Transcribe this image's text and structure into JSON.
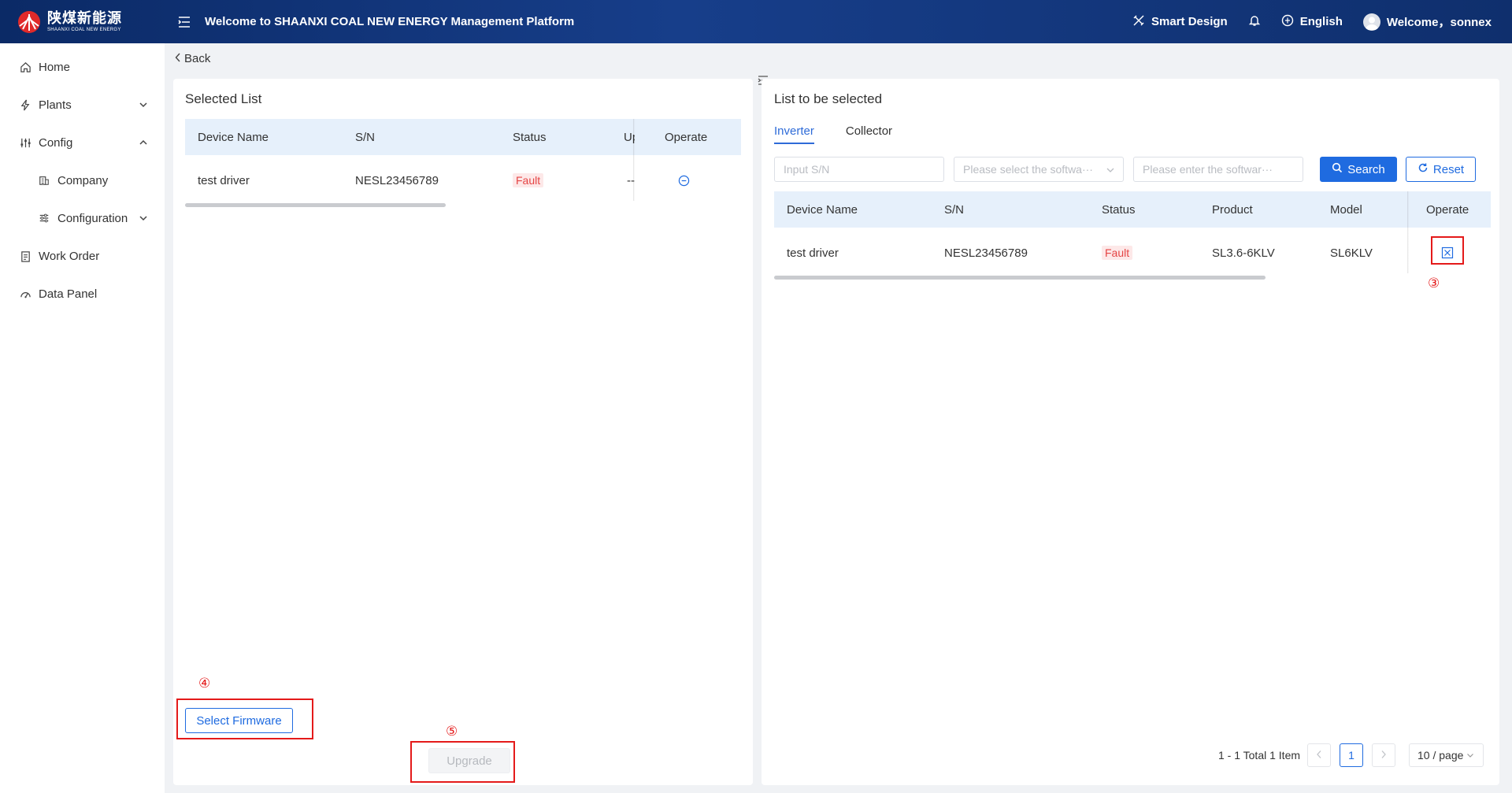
{
  "header": {
    "logo_cn": "陕煤新能源",
    "logo_en": "SHAANXI COAL NEW ENERGY",
    "title": "Welcome to SHAANXI COAL NEW ENERGY Management Platform",
    "smart_design": "Smart Design",
    "language": "English",
    "welcome": "Welcome，sonnex",
    "colors": {
      "bar_start": "#0b2a66",
      "bar_end": "#173e8a"
    }
  },
  "sidebar": {
    "items": [
      {
        "label": "Home",
        "icon": "home-icon"
      },
      {
        "label": "Plants",
        "icon": "lightning-icon",
        "chevron": "down"
      },
      {
        "label": "Config",
        "icon": "sliders-icon",
        "chevron": "up"
      },
      {
        "label": "Company",
        "icon": "building-icon",
        "sub": true
      },
      {
        "label": "Configuration",
        "icon": "sliders-icon",
        "sub": true,
        "chevron": "down"
      },
      {
        "label": "Work Order",
        "icon": "clipboard-icon"
      },
      {
        "label": "Data Panel",
        "icon": "gauge-icon"
      }
    ]
  },
  "back_label": "Back",
  "left_panel": {
    "title": "Selected List",
    "columns": [
      "Device Name",
      "S/N",
      "Status",
      "Up",
      "Operate"
    ],
    "rows": [
      {
        "device_name": "test driver",
        "sn": "NESL23456789",
        "status": "Fault",
        "upgrade": "--"
      }
    ],
    "select_firmware": "Select Firmware",
    "upgrade": "Upgrade"
  },
  "right_panel": {
    "title": "List to be selected",
    "tabs": [
      "Inverter",
      "Collector"
    ],
    "active_tab": "Inverter",
    "filters": {
      "sn_placeholder": "Input S/N",
      "software_select_placeholder": "Please select the softwa···",
      "software_input_placeholder": "Please enter the softwar···"
    },
    "search": "Search",
    "reset": "Reset",
    "columns": [
      "Device Name",
      "S/N",
      "Status",
      "Product",
      "Model",
      "Operate"
    ],
    "rows": [
      {
        "device_name": "test driver",
        "sn": "NESL23456789",
        "status": "Fault",
        "product": "SL3.6-6KLV",
        "model": "SL6KLV"
      }
    ],
    "pagination": {
      "summary": "1 - 1 Total 1 Item",
      "current_page": "1",
      "page_size": "10 / page"
    }
  },
  "annotations": [
    "③",
    "④",
    "⑤"
  ],
  "colors": {
    "primary": "#1f6be0",
    "fault": "#e54545",
    "annotation": "#e41a1a"
  }
}
